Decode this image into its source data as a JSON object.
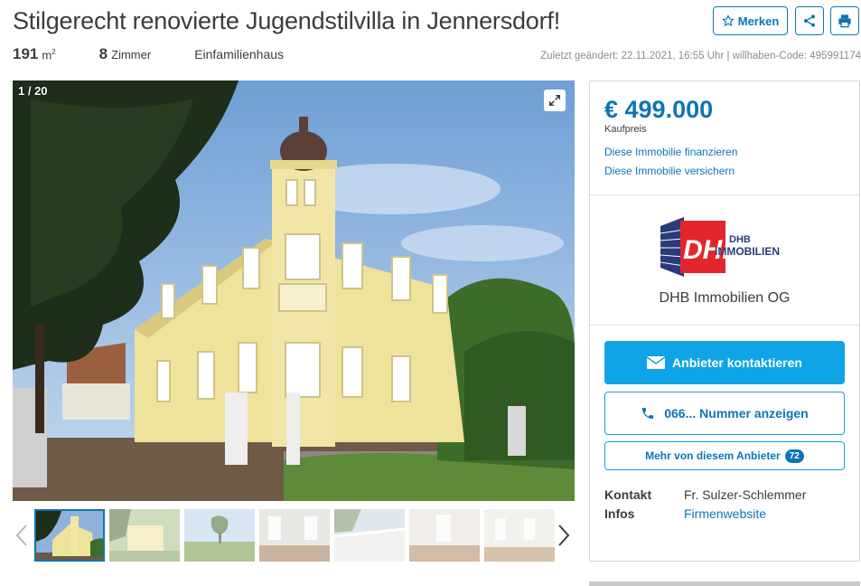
{
  "listing": {
    "title": "Stilgerecht renovierte Jugendstilvilla in Jennersdorf!",
    "area_value": "191",
    "area_unit": "m",
    "area_unit_sup": "2",
    "rooms_value": "8",
    "rooms_label": "Zimmer",
    "type": "Einfamilienhaus",
    "meta": "Zuletzt geändert: 22.11.2021, 16:55 Uhr | willhaben-Code: 495991174"
  },
  "actions": {
    "merken_label": "Merken",
    "share_icon": "share-icon",
    "print_icon": "print-icon"
  },
  "gallery": {
    "counter": "1 / 20",
    "expand_icon": "expand-icon",
    "thumb_count": 7,
    "active_thumb": 1
  },
  "sidebar": {
    "price": "€ 499.000",
    "price_label": "Kaufpreis",
    "finance_link": "Diese Immobilie finanzieren",
    "insure_link": "Diese Immobilie versichern",
    "logo_text_main": "DHB",
    "logo_text_small": "DHB",
    "logo_text_sub": "IMMOBILIEN",
    "company": "DHB Immobilien OG",
    "contact_label": "Anbieter kontaktieren",
    "phone_label": "066... Nummer anzeigen",
    "more_label": "Mehr von diesem Anbieter",
    "more_count": "72",
    "kontakt_label": "Kontakt",
    "kontakt_value": "Fr. Sulzer-Schlemmer",
    "infos_label": "Infos",
    "infos_link": "Firmenwebsite"
  },
  "colors": {
    "brand_blue": "#0d75b5",
    "button_blue": "#0fa4e5",
    "logo_red": "#e3262c",
    "logo_navy": "#2b3a7a"
  }
}
